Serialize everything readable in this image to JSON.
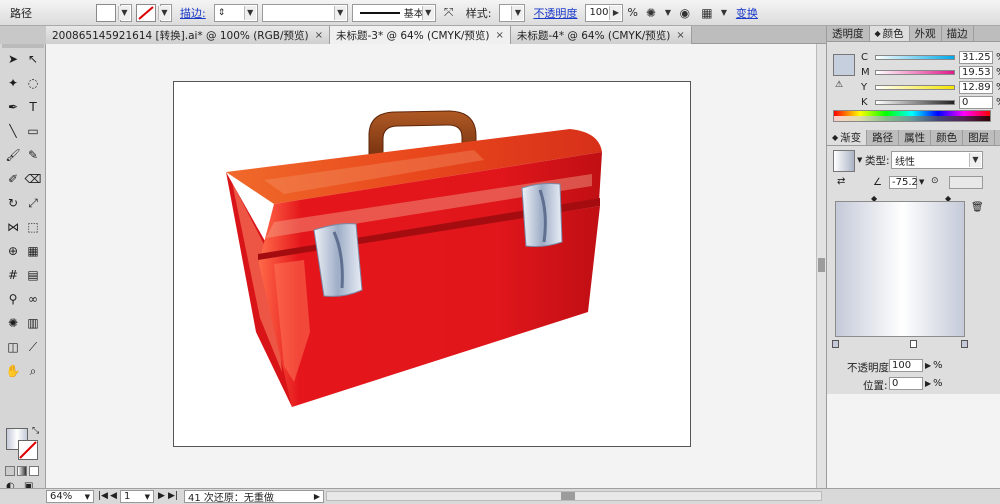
{
  "control_bar": {
    "label": "路径",
    "stroke_label": "描边:",
    "stroke_profile": "基本",
    "style_label": "样式:",
    "opacity_label": "不透明度",
    "opacity_value": "100",
    "percent": "%",
    "transform_label": "变换"
  },
  "tabs": [
    {
      "label": "200865145921614 [转换].ai* @ 100% (RGB/预览)",
      "close": "×"
    },
    {
      "label": "未标题-3* @ 64% (CMYK/预览)",
      "close": "×"
    },
    {
      "label": "未标题-4* @ 64% (CMYK/预览)",
      "close": "×"
    }
  ],
  "toolbar": {
    "icons": [
      "selection-tool-icon",
      "direct-selection-tool-icon",
      "magic-wand-tool-icon",
      "lasso-tool-icon",
      "pen-tool-icon",
      "type-tool-icon",
      "line-tool-icon",
      "rectangle-tool-icon",
      "paintbrush-tool-icon",
      "pencil-tool-icon",
      "blob-brush-tool-icon",
      "eraser-tool-icon",
      "rotate-tool-icon",
      "scale-tool-icon",
      "width-tool-icon",
      "free-transform-tool-icon",
      "shape-builder-tool-icon",
      "perspective-tool-icon",
      "mesh-tool-icon",
      "gradient-tool-icon",
      "eyedropper-tool-icon",
      "blend-tool-icon",
      "symbol-sprayer-tool-icon",
      "graph-tool-icon",
      "artboard-tool-icon",
      "slice-tool-icon",
      "hand-tool-icon",
      "zoom-tool-icon"
    ]
  },
  "status_bar": {
    "zoom": "64%",
    "page": "1",
    "message": "41 次还原：无重做"
  },
  "color_panel": {
    "tabs": [
      "透明度",
      "颜色",
      "外观",
      "描边"
    ],
    "active_tab": "颜色",
    "channels": [
      {
        "name": "C",
        "value": "31.25",
        "color": "#00a8e8"
      },
      {
        "name": "M",
        "value": "19.53",
        "color": "#e0198c"
      },
      {
        "name": "Y",
        "value": "12.89",
        "color": "#f5e400"
      },
      {
        "name": "K",
        "value": "0",
        "color": "#222222"
      }
    ],
    "percent": "%"
  },
  "gradient_panel": {
    "tabs": [
      "渐变",
      "路径",
      "属性",
      "颜色",
      "图层"
    ],
    "active_tab": "渐变",
    "type_label": "类型:",
    "type_value": "线性",
    "angle_value": "-75.2",
    "opacity_label": "不透明度:",
    "opacity_value": "100",
    "location_label": "位置:",
    "location_value": "0",
    "percent": "%"
  },
  "artwork": {
    "body_color": "#e4151b",
    "lid_color": "#e8441c",
    "handle_color": "#8b3a12",
    "latch_color": "#d9e2ee"
  }
}
